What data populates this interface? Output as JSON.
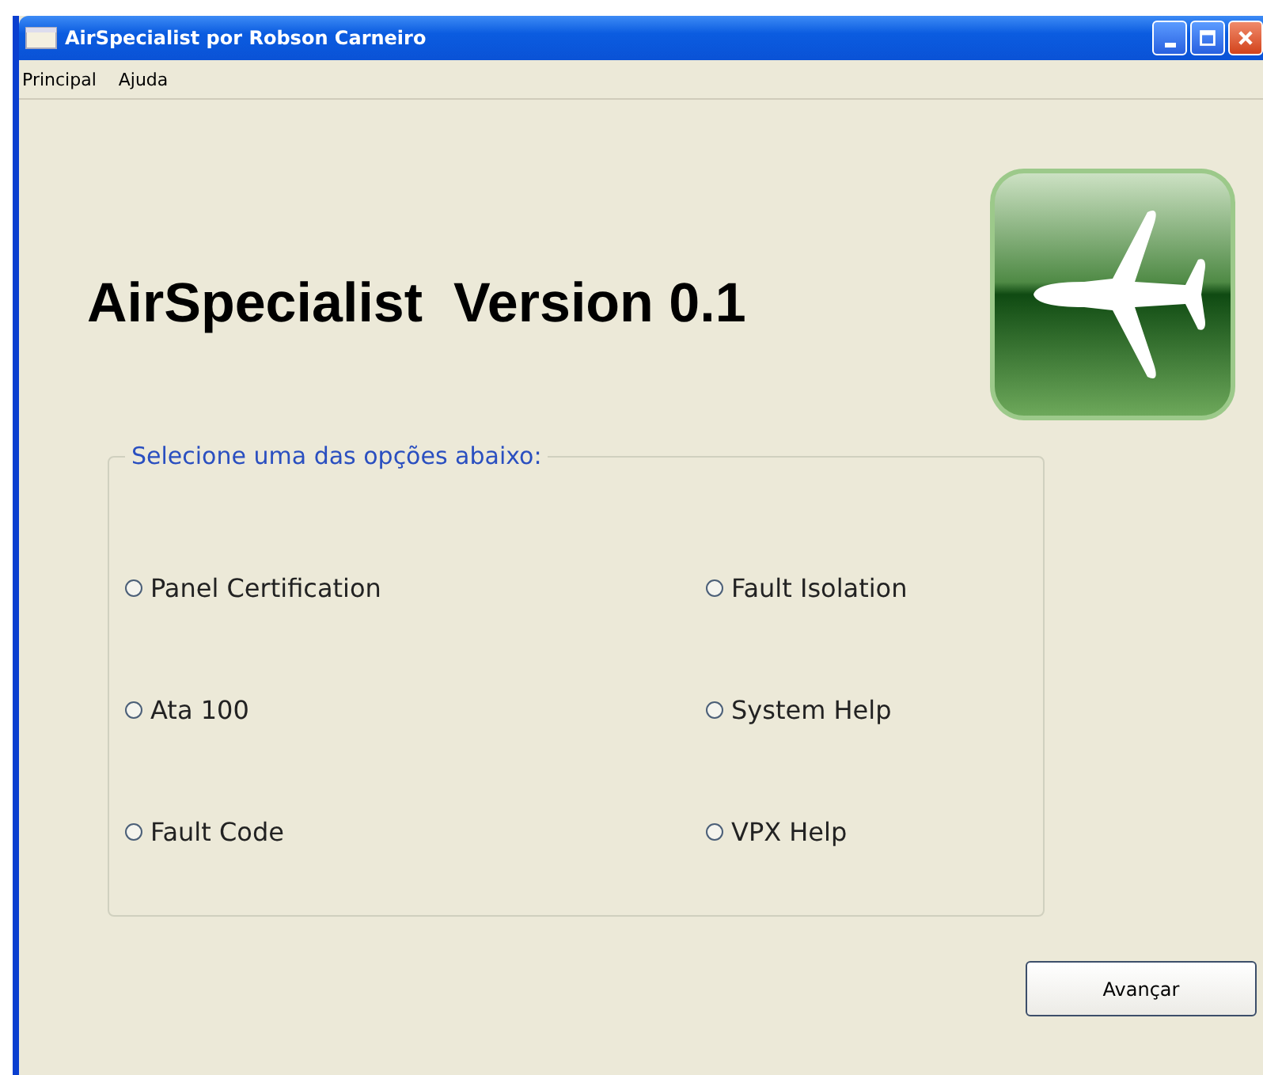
{
  "window": {
    "title": "AirSpecialist por Robson Carneiro"
  },
  "menu": [
    {
      "label": "Principal"
    },
    {
      "label": "Ajuda"
    }
  ],
  "heading": "AirSpecialist  Version 0.1",
  "group": {
    "legend": "Selecione uma das opções abaixo:",
    "options": [
      {
        "label": "Panel Certification",
        "selected": false
      },
      {
        "label": "Fault Isolation",
        "selected": false
      },
      {
        "label": "Ata 100",
        "selected": false
      },
      {
        "label": "System Help",
        "selected": false
      },
      {
        "label": "Fault Code",
        "selected": false
      },
      {
        "label": "VPX Help",
        "selected": false
      }
    ]
  },
  "buttons": [
    {
      "label": "Avançar"
    }
  ]
}
